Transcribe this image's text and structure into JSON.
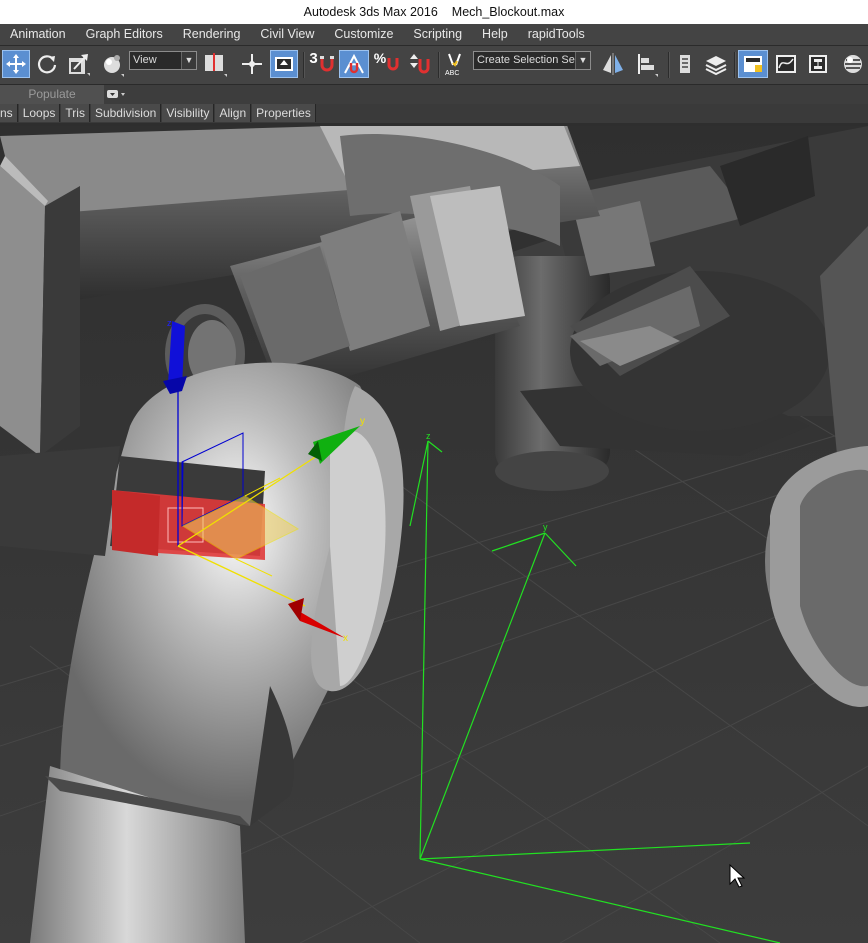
{
  "window": {
    "app_title": "Autodesk 3ds Max 2016",
    "file_name": "Mech_Blockout.max"
  },
  "menu": [
    "Animation",
    "Graph Editors",
    "Rendering",
    "Civil View",
    "Customize",
    "Scripting",
    "Help",
    "rapidTools"
  ],
  "toolbar": {
    "reference_coord_value": "View",
    "snap_label": "3",
    "percent_snap_label": "%",
    "named_selection_placeholder": "Create Selection Se",
    "abc_label": "ABC"
  },
  "ribbon": {
    "tabs_row1": [
      "Populate"
    ],
    "tabs_row2": [
      "ns",
      "Loops",
      "Tris",
      "Subdivision",
      "Visibility",
      "Align",
      "Properties"
    ]
  },
  "viewport": {
    "gizmo_axes": {
      "x": "x",
      "y": "y",
      "z": "z"
    },
    "light_helper_axes": {
      "y": "y",
      "z": "z"
    }
  },
  "colors": {
    "axis_x": "#d80000",
    "axis_y": "#00a000",
    "axis_z": "#0000d0",
    "selection_face": "#e03a3a",
    "helper_lines": "#22e022",
    "active_tool": "#5b8fd1"
  }
}
